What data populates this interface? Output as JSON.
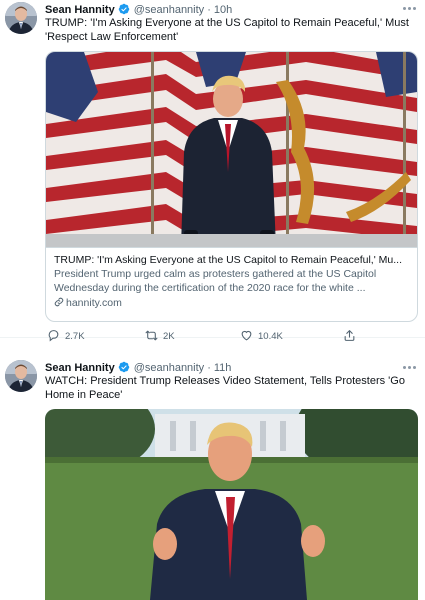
{
  "tweets": [
    {
      "author": {
        "name": "Sean Hannity",
        "handle": "@seanhannity",
        "time": "10h"
      },
      "separator": "·",
      "text": "TRUMP: 'I'm Asking Everyone at the US Capitol to Remain Peaceful,' Must 'Respect Law Enforcement'",
      "card": {
        "title": "TRUMP: 'I'm Asking Everyone at the US Capitol to Remain Peaceful,' Mu...",
        "description": "President Trump urged calm as protesters gathered at the US Capitol Wednesday during the certification of the 2020 race for the white ...",
        "domain": "hannity.com"
      },
      "actions": {
        "replies": "2.7K",
        "retweets": "2K",
        "likes": "10.4K"
      }
    },
    {
      "author": {
        "name": "Sean Hannity",
        "handle": "@seanhannity",
        "time": "11h"
      },
      "separator": "·",
      "text": "WATCH: President Trump Releases Video Statement, Tells Protesters 'Go Home in Peace'"
    }
  ],
  "colors": {
    "verified": "#1d9bf0",
    "secondary_text": "#536471",
    "border": "#cfd9de"
  },
  "icons": {
    "verified": "verified-badge-icon",
    "more": "more-options-icon",
    "link": "link-icon",
    "reply": "reply-icon",
    "retweet": "retweet-icon",
    "like": "heart-icon",
    "share": "share-icon"
  }
}
